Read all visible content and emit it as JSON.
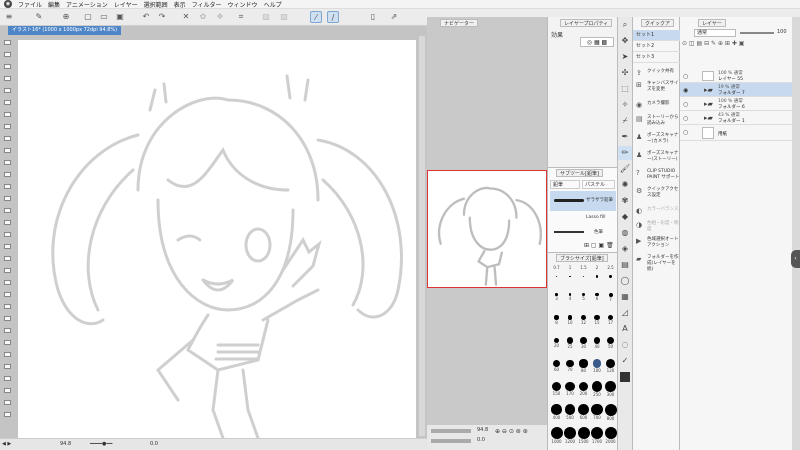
{
  "menubar": {
    "items": [
      "ファイル",
      "編集",
      "アニメーション",
      "レイヤー",
      "選択範囲",
      "表示",
      "フィルター",
      "ウィンドウ",
      "ヘルプ"
    ]
  },
  "document": {
    "tab_title": "イラスト16* (1000 x 1000px 72dpi 94.8%)",
    "zoom_status": "94.8",
    "rotation_status": "0.0"
  },
  "panels": {
    "navigator_tab": "ナビゲーター",
    "layer_property_tab": "レイヤープロパティ",
    "effect_label": "効果",
    "subtool_tab": "サブツール[鉛筆]",
    "subtool_groups": [
      "鉛筆",
      "パステル"
    ],
    "subtool_items": [
      "ザラザラ鉛筆",
      "Lasso fill",
      "色筆"
    ],
    "brush_size_tab": "ブラシサイズ[鉛筆]",
    "quick_access_tab": "クイックア",
    "layer_tab": "レイヤー",
    "blend_mode": "通常",
    "opacity": "100"
  },
  "brush_sizes": [
    "0.7",
    "1",
    "1.5",
    "2",
    "2.5",
    "3",
    "4",
    "5",
    "6",
    "7",
    "8",
    "10",
    "12",
    "15",
    "17",
    "20",
    "25",
    "30",
    "40",
    "50",
    "60",
    "70",
    "80",
    "100",
    "120",
    "150",
    "170",
    "200",
    "250",
    "300",
    "400",
    "500",
    "600",
    "700",
    "800",
    "1000",
    "1200",
    "1500",
    "1700",
    "2000"
  ],
  "quick_access": {
    "sets": [
      "セット1",
      "セット2",
      "セット3"
    ],
    "items": [
      "クイック共有",
      "キャンバスサイズを変更",
      "カメラ撮影",
      "ストーリーから読み込み",
      "ポーズスキャナー(カメラ)",
      "ポーズスキャナー(ストーリー)",
      "CLIP STUDIO PAINT サポート",
      "クイックアクセス設定",
      "カラーバランス",
      "色相・彩度・明度",
      "色域選択オートアクション",
      "フォルダーを作成(レイヤーを統)"
    ]
  },
  "layers": [
    {
      "mode": "100 % 通常",
      "name": "レイヤー 55",
      "kind": "layer",
      "selected": false
    },
    {
      "mode": "19 % 通常",
      "name": "フォルダー 7",
      "kind": "folder",
      "selected": true
    },
    {
      "mode": "100 % 通常",
      "name": "フォルダー 6",
      "kind": "folder",
      "selected": false
    },
    {
      "mode": "43 % 通常",
      "name": "フォルダー 1",
      "kind": "folder",
      "selected": false
    },
    {
      "mode": "",
      "name": "用紙",
      "kind": "paper",
      "selected": false
    }
  ],
  "colors": {
    "accent": "#4e86c8",
    "selected_row": "#c6d9ee",
    "sketch_line": "#cfcfcf",
    "nav_border": "#dd3333"
  }
}
